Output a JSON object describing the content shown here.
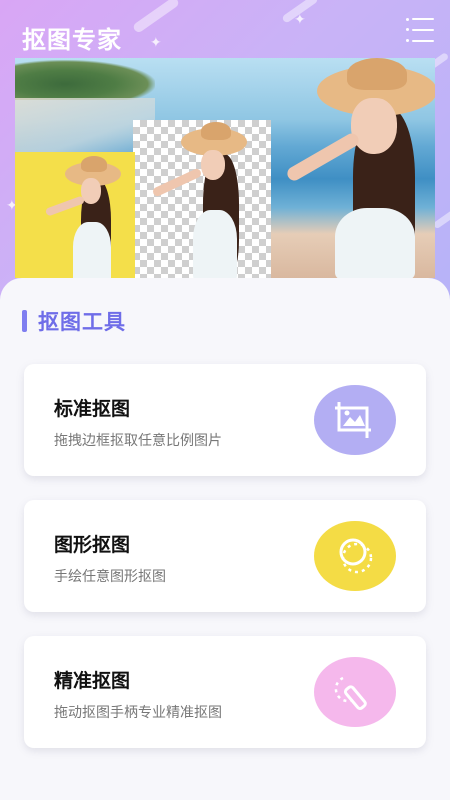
{
  "header": {
    "title": "抠图专家",
    "menu_icon": "menu-list-icon"
  },
  "section": {
    "title": "抠图工具",
    "accent": "#7f7ef0"
  },
  "tools": [
    {
      "title": "标准抠图",
      "subtitle": "拖拽边框抠取任意比例图片",
      "icon": "image-crop-icon",
      "color": "#b3aef3"
    },
    {
      "title": "图形抠图",
      "subtitle": "手绘任意图形抠图",
      "icon": "lasso-shape-icon",
      "color": "#f4dc45"
    },
    {
      "title": "精准抠图",
      "subtitle": "拖动抠图手柄专业精准抠图",
      "icon": "precision-brush-icon",
      "color": "#f5b8ec"
    }
  ]
}
